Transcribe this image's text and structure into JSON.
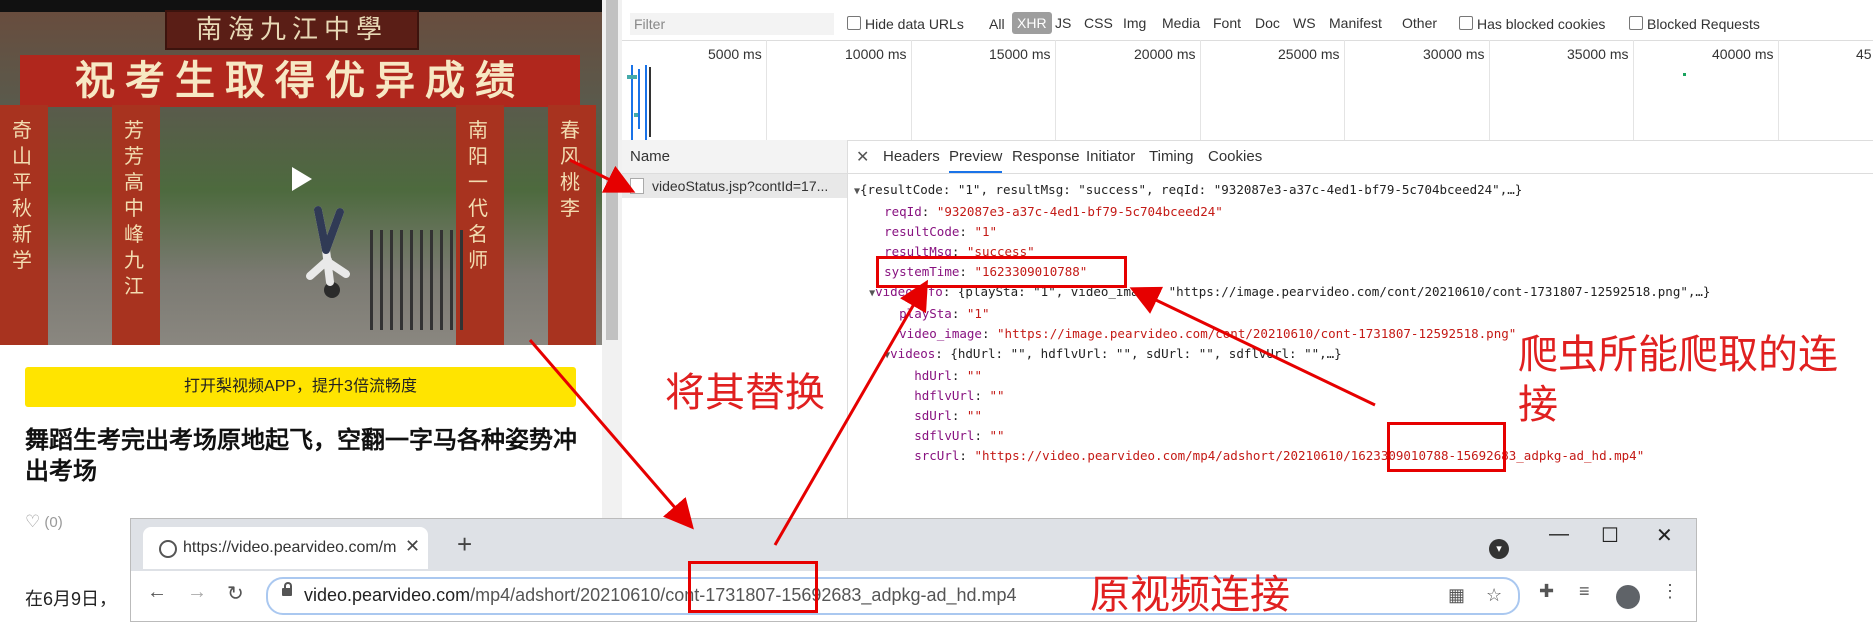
{
  "video": {
    "plaque_text": "南海九江中學",
    "banner_text": "祝考生取得优异成绩",
    "pillar_texts": [
      "奇山平秋新学",
      "芳芳高中峰九江",
      "南阳一代名师",
      "春风桃李"
    ]
  },
  "page": {
    "app_banner": "打开梨视频APP，提升3倍流畅度",
    "title": "舞蹈生考完出考场原地起飞，空翻一字马各种姿势冲出考场",
    "likes": "(0)",
    "text_start": "在6月9日，"
  },
  "devtools": {
    "filter_placeholder": "Filter",
    "hide_data_urls": "Hide data URLs",
    "all": "All",
    "types": [
      "XHR",
      "JS",
      "CSS",
      "Img",
      "Media",
      "Font",
      "Doc",
      "WS",
      "Manifest",
      "Other"
    ],
    "has_blocked_cookies": "Has blocked cookies",
    "blocked_requests": "Blocked Requests",
    "timeline_labels": [
      "5000 ms",
      "10000 ms",
      "15000 ms",
      "20000 ms",
      "25000 ms",
      "30000 ms",
      "35000 ms",
      "40000 ms",
      "45"
    ],
    "name_header": "Name",
    "request_name": "videoStatus.jsp?contId=17...",
    "tabs": [
      "Headers",
      "Preview",
      "Response",
      "Initiator",
      "Timing",
      "Cookies"
    ],
    "active_tab": "Preview",
    "json": {
      "root_summary": "{resultCode: \"1\", resultMsg: \"success\", reqId: \"932087e3-a37c-4ed1-bf79-5c704bceed24\",…}",
      "reqId": "\"932087e3-a37c-4ed1-bf79-5c704bceed24\"",
      "resultCode": "\"1\"",
      "resultMsg": "\"success\"",
      "systemTime": "\"1623309010788\"",
      "videoInfo_summary": "{playSta: \"1\", video_image: \"https://image.pearvideo.com/cont/20210610/cont-1731807-12592518.png\",…}",
      "playSta": "\"1\"",
      "video_image": "\"https://image.pearvideo.com/cont/20210610/cont-1731807-12592518.png\"",
      "videos_summary": "{hdUrl: \"\", hdflvUrl: \"\", sdUrl: \"\", sdflvUrl: \"\",…}",
      "hdUrl": "\"\"",
      "hdflvUrl": "\"\"",
      "sdUrl": "\"\"",
      "sdflvUrl": "\"\"",
      "srcUrl": "\"https://video.pearvideo.com/mp4/adshort/20210610/1623309010788-15692683_adpkg-ad_hd.mp4\""
    }
  },
  "chrome": {
    "tab_title": "https://video.pearvideo.com/m",
    "url_host": "video.pearvideo.com",
    "url_path": "/mp4/adshort/20210610/cont-1731807-15692683_adpkg-ad_hd.mp4"
  },
  "annotations": {
    "replace": "将其替换",
    "crawler": "爬虫所能爬取的连接",
    "original": "原视频连接"
  },
  "colors": {
    "annotation": "#e02020",
    "accent": "#1a73e8",
    "banner": "#ffe400"
  }
}
